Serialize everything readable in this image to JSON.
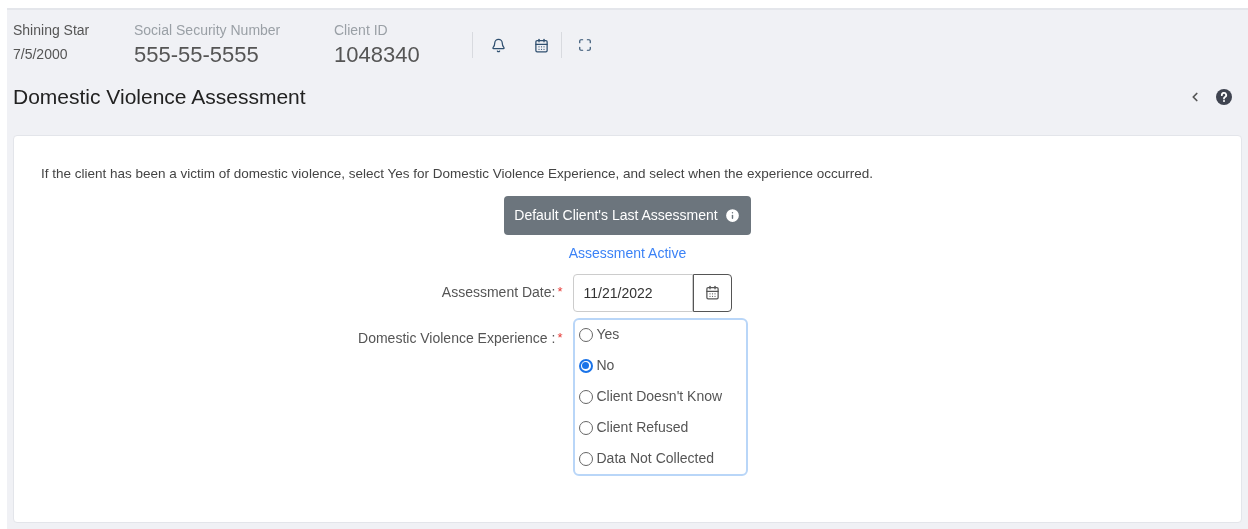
{
  "client": {
    "name": "Shining Star",
    "dob": "7/5/2000"
  },
  "header_fields": [
    {
      "label": "Social Security Number",
      "value": "555-55-5555"
    },
    {
      "label": "Client ID",
      "value": "1048340"
    }
  ],
  "page_title": "Domestic Violence Assessment",
  "instructions": "If the client has been a victim of domestic violence, select Yes for Domestic Violence Experience, and select when the experience occurred.",
  "default_button": "Default Client's Last Assessment",
  "status_link": "Assessment Active",
  "assessment_date": {
    "label": "Assessment Date:",
    "required_mark": "*",
    "value": "11/21/2022"
  },
  "experience": {
    "label": "Domestic Violence Experience :",
    "required_mark": "*",
    "options": [
      {
        "label": "Yes",
        "selected": false
      },
      {
        "label": "No",
        "selected": true
      },
      {
        "label": "Client Doesn't Know",
        "selected": false
      },
      {
        "label": "Client Refused",
        "selected": false
      },
      {
        "label": "Data Not Collected",
        "selected": false
      }
    ]
  }
}
